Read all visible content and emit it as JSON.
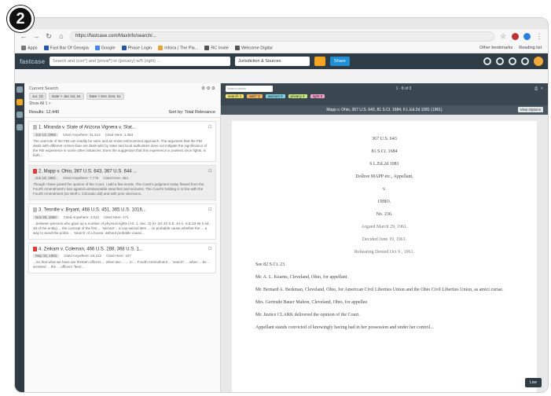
{
  "badge": {
    "number": "2"
  },
  "browser": {
    "url": "https://fastcase.com/MaxInfo/search/...",
    "bookmarks": [
      "Apps",
      "Fast Bar Of Georgia",
      "Google",
      "Phase Login",
      "Inforia | The Pla...",
      "RC Invite",
      "Welcome Digital"
    ],
    "bookmarks_right": [
      "Other bookmarks",
      "Reading list"
    ]
  },
  "appbar": {
    "search_value": "Search and (con*) and (privat*) or (privacy) w/5 (right) ...",
    "jurisdiction": "Jurisdiction & Sources",
    "share_label": "Share"
  },
  "results": {
    "heading": "Current Search",
    "chips": [
      "Jur. (3)",
      "Date > Jan 1st, 61",
      "Date < Dec 31st, 61"
    ],
    "show_all": "Show All 1 >",
    "count_label": "Results: 12,440",
    "sort_label": "Sort by: Total Relevance",
    "cards": [
      {
        "title": "1. Miranda v. State of Arizona Vignera v. Stat...",
        "date": "Jun 13, 1966",
        "cited_gen": "Cited Anywhere: 31,514",
        "cited_here": "Cited Here: 1,384",
        "snippet": "The overrule of the FBI can readily be seen and an entire enforcement approach. The argument that the FBI deals with different crimes than are dealt with by state and local authorities does not mitigate the significance of the FBI experience in some other instances. Even the suggestion that this experience is useless once fights, is both..."
      },
      {
        "title": "2. Mapp v. Ohio, 367 U.S. 643, 367 U.S. 644 ...",
        "date": "Jun 19, 1961",
        "cited_gen": "Cited Anywhere: 7,776",
        "cited_here": "Cited Here: 454",
        "snippet": "Though I have joined the opinion of the Court, I add a few words. The Court's judgment today flowed from the Fourth Amendment's ban against unreasonable searches and seizures. The Court's holding is in line with the Fourth Amendment (as Wolf v. Colorado did) and with prior decisions."
      },
      {
        "title": "3. Tennille v. Bryant, 468 U.S. 451, 365 U.S. 1016...",
        "date": "Nov 25, 1960",
        "cited_gen": "Cited Anywhere: 4,512",
        "cited_here": "Cited Here: 471",
        "snippet": "...between persons who gave up a number of physical rights (Art. 1, Sec. 3) (H. 2d, 42 S.E. 44 A, S.E.2d 96 2 ed. 3d of the entity) ... the concept of the first ... 'seizure'... a cop-seized item ... on probable cause whether the ... a way to avoid the police ... 'search' of a house, without probable cause..."
      },
      {
        "title": "4. Zeikam v. Coleman, 466 U.S. 288, 368 U.S. 1...",
        "date": "May 15, 1961",
        "cited_gen": "Cited Anywhere: 63,212",
        "cited_here": "Cited Here: 107",
        "snippet": "...So that what we have are thirteen officers ... when two ... ... in ... Fourth Amendment ... 'search' ... when ... be ... arrested ... the ... officers' 'fees'..."
      }
    ]
  },
  "doc": {
    "search_placeholder": "Search within",
    "hits_label": "1 · 8 of 3",
    "highlights": [
      {
        "text": "search 1",
        "color": "#f8e36b"
      },
      {
        "text": "seiz* 2",
        "color": "#f9b45a"
      },
      {
        "text": "warrant 3",
        "color": "#7dd3e0"
      },
      {
        "text": "privacy 4",
        "color": "#c8e87e"
      },
      {
        "text": "right 5",
        "color": "#f5a2c7"
      }
    ],
    "citation_title": "Mapp v. Ohio, 367 U.S. 643, 81 S.Ct. 1684, 6 L.Ed.2d 1081 (1961)",
    "view_options": "View Options",
    "lines_center": [
      "367 U.S. 643",
      "81 S.Ct. 1684",
      "6 L.Ed.2d 1081",
      "Dollree MAPP etc., Appellant,",
      "v.",
      "OHIO.",
      "No. 236."
    ],
    "lines_center_dim": [
      "Argued March 29, 1961.",
      "Decided June 19, 1961.",
      "Rehearing Denied Oct 9 , 1961."
    ],
    "lines_left": [
      "See 82 S.Ct. 23.",
      "Mr. A. L. Kearns, Cleveland, Ohio, for appellant.",
      "Mr. Bernard A. Berkman, Cleveland, Ohio, for American Civil Liberties Union and the Ohio Civil Liberties Union, as amici curiae.",
      "Mrs. Gertrude Bauer Mahon, Cleveland, Ohio, for appellee.",
      "Mr. Justice CLARK delivered the opinion of the Court.",
      "Appellant stands convicted of knowingly having had in her possession and under her control..."
    ],
    "chat_label": "Live"
  },
  "colors": {
    "appbar": "#2f3b45",
    "accent_orange": "#f4a623",
    "share_blue": "#1f8fd6",
    "flag_red": "#e23a3a"
  }
}
